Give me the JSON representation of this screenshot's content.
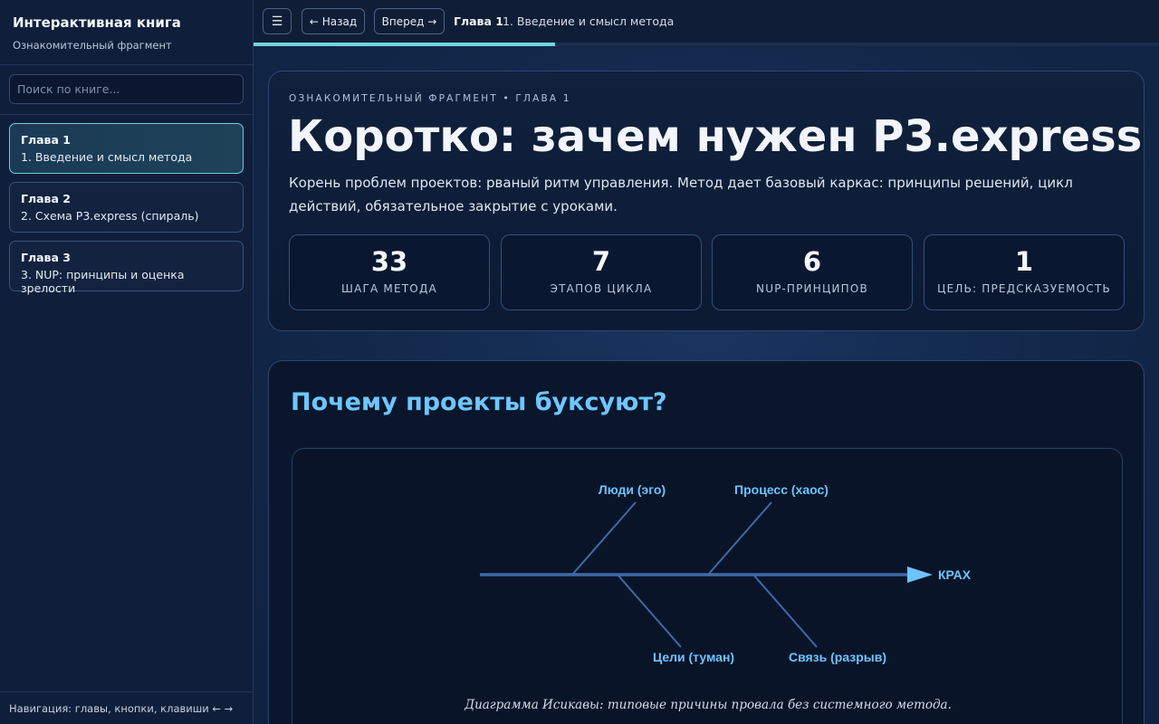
{
  "sidebar": {
    "title": "Интерактивная книга",
    "subtitle": "Ознакомительный фрагмент",
    "search_placeholder": "Поиск по книге...",
    "chapters": [
      {
        "name": "Глава 1",
        "title": "1. Введение и смысл метода",
        "active": true
      },
      {
        "name": "Глава 2",
        "title": "2. Схема P3.express (спираль)",
        "active": false
      },
      {
        "name": "Глава 3",
        "title": "3. NUP: принципы и оценка зрелости",
        "active": false
      }
    ],
    "footer": "Навигация: главы, кнопки, клавиши ← →"
  },
  "topbar": {
    "menu_icon": "☰",
    "back_label": "← Назад",
    "forward_label": "Вперед →",
    "crumb_chapter": "Глава 1",
    "crumb_title": "1. Введение и смысл метода",
    "progress": 0.333
  },
  "hero": {
    "kicker": "ОЗНАКОМИТЕЛЬНЫЙ ФРАГМЕНТ • ГЛАВА 1",
    "title": "Коротко: зачем нужен P3.express",
    "description": "Корень проблем проектов: рваный ритм управления. Метод дает базовый каркас: принципы решений, цикл действий, обязательное закрытие с уроками.",
    "stats": [
      {
        "value": "33",
        "label": "ШАГА МЕТОДА"
      },
      {
        "value": "7",
        "label": "ЭТАПОВ ЦИКЛА"
      },
      {
        "value": "6",
        "label": "NUP-ПРИНЦИПОВ"
      },
      {
        "value": "1",
        "label": "ЦЕЛЬ: ПРЕДСКАЗУЕМОСТЬ"
      }
    ]
  },
  "section": {
    "title": "Почему проекты буксуют?",
    "diagram": {
      "head": "КРАХ",
      "causes_top": [
        "Люди (эго)",
        "Процесс (хаос)"
      ],
      "causes_bottom": [
        "Цели (туман)",
        "Связь (разрыв)"
      ],
      "line_color": "#3f6aa8",
      "accent_color": "#6cc4ff"
    },
    "caption": "Диаграмма Исикавы: типовые причины провала без системного метода."
  }
}
